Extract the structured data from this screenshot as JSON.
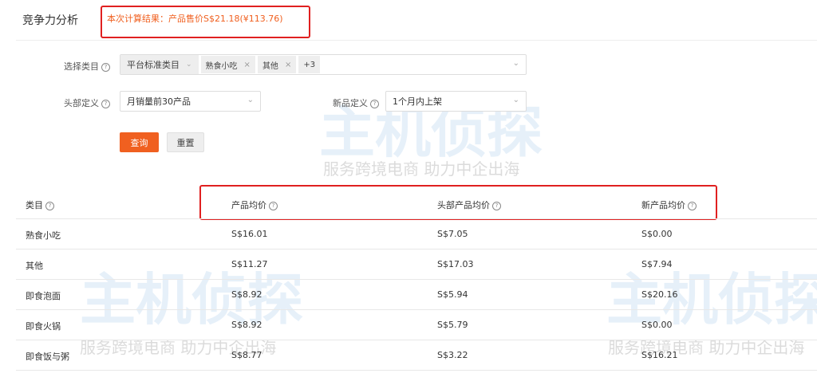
{
  "header": {
    "title": "竞争力分析",
    "result": "本次计算结果：产品售价S$21.18(¥113.76)"
  },
  "filters": {
    "category_label": "选择类目",
    "category_type": "平台标准类目",
    "category_tags": [
      "熟食小吃",
      "其他"
    ],
    "category_more": "+3",
    "head_label": "头部定义",
    "head_value": "月销量前30产品",
    "new_label": "新品定义",
    "new_value": "1个月内上架",
    "query_button": "查询",
    "reset_button": "重置"
  },
  "table": {
    "headers": [
      "类目",
      "产品均价",
      "头部产品均价",
      "新产品均价"
    ],
    "rows": [
      [
        "熟食小吃",
        "S$16.01",
        "S$7.05",
        "S$0.00"
      ],
      [
        "其他",
        "S$11.27",
        "S$17.03",
        "S$7.94"
      ],
      [
        "即食泡面",
        "S$8.92",
        "S$5.94",
        "S$20.16"
      ],
      [
        "即食火锅",
        "S$8.92",
        "S$5.79",
        "S$0.00"
      ],
      [
        "即食饭与粥",
        "S$8.77",
        "S$3.22",
        "S$16.21"
      ]
    ]
  },
  "watermark": {
    "logo": "主机侦探",
    "slogan": "服务跨境电商 助力中企出海"
  },
  "colors": {
    "accent": "#f06020",
    "highlight": "#e02020"
  }
}
